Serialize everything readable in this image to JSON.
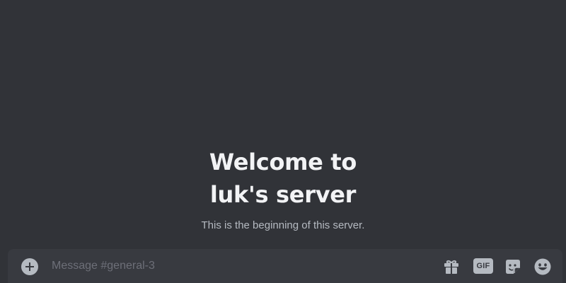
{
  "welcome": {
    "title_line1": "Welcome to",
    "title_line2": "luk's server",
    "subtitle": "This is the beginning of this server."
  },
  "composer": {
    "placeholder": "Message #general-3",
    "attach_icon": "plus-circle-icon",
    "tools": {
      "gift_icon": "gift-icon",
      "gif_label": "GIF",
      "sticker_icon": "sticker-icon",
      "emoji_icon": "smiley-icon"
    }
  },
  "colors": {
    "background": "#313338",
    "composer": "#383a40",
    "icon": "#b5bac1",
    "title": "#f2f3f5",
    "subtitle": "#b5bac1",
    "placeholder": "#6d6f78"
  }
}
